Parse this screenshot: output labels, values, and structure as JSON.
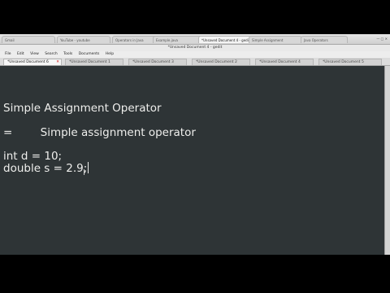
{
  "browser": {
    "tabs": [
      "Gmail",
      "YouTube - youtube",
      "Operators in Java",
      "Example.java",
      "*Unsaved Document 4 - gedit",
      "Simple Assignment",
      "Java Operators"
    ],
    "controls": "— ▢ ✕"
  },
  "window": {
    "title": "*Unsaved Document 4 - gedit"
  },
  "menu": [
    "File",
    "Edit",
    "View",
    "Search",
    "Tools",
    "Documents",
    "Help"
  ],
  "doc_tabs": [
    "*Unsaved Document 6",
    "*Unsaved Document 1",
    "*Unsaved Document 3",
    "*Unsaved Document 2",
    "*Unsaved Document 4",
    "*Unsaved Document 5"
  ],
  "editor": {
    "line1": "Simple Assignment Operator",
    "line2": "=        Simple assignment operator",
    "line3": "int d = 10;",
    "line4": "double s = 2.9;"
  }
}
